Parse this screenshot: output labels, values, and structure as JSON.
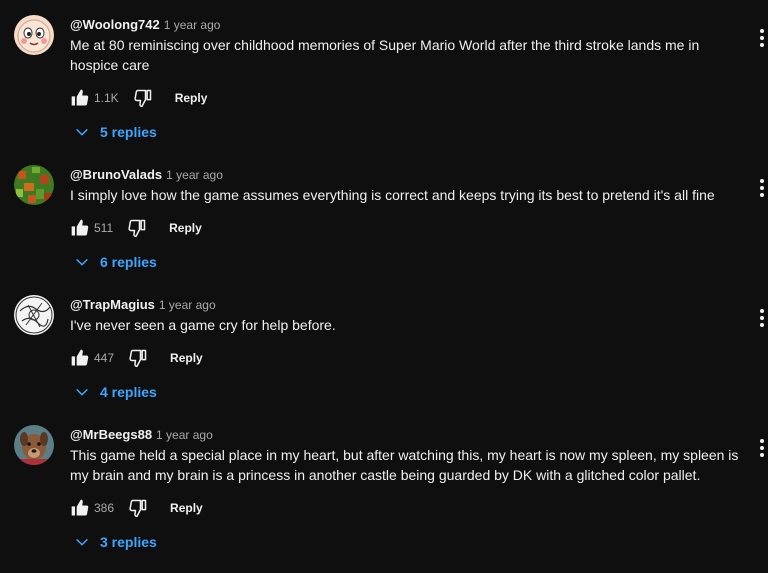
{
  "comments": [
    {
      "author": "@Woolong742",
      "time": "1 year ago",
      "text": "Me at 80 reminiscing over childhood memories of Super Mario World after the third stroke lands me in hospice care",
      "likes": "1.1K",
      "reply_label": "Reply",
      "replies_label": "5 replies"
    },
    {
      "author": "@BrunoValads",
      "time": "1 year ago",
      "text": "I simply love how the game assumes everything is correct and keeps trying its best to pretend it's all fine",
      "likes": "511",
      "reply_label": "Reply",
      "replies_label": "6 replies"
    },
    {
      "author": "@TrapMagius",
      "time": "1 year ago",
      "text": "I've never seen a game cry for help before.",
      "likes": "447",
      "reply_label": "Reply",
      "replies_label": "4 replies"
    },
    {
      "author": "@MrBeegs88",
      "time": "1 year ago",
      "text": "This game held a special place in my heart, but after watching this, my heart is now my spleen, my spleen is my brain and my brain is a princess in another castle being guarded by DK with a glitched color pallet.",
      "likes": "386",
      "reply_label": "Reply",
      "replies_label": "3 replies"
    }
  ]
}
